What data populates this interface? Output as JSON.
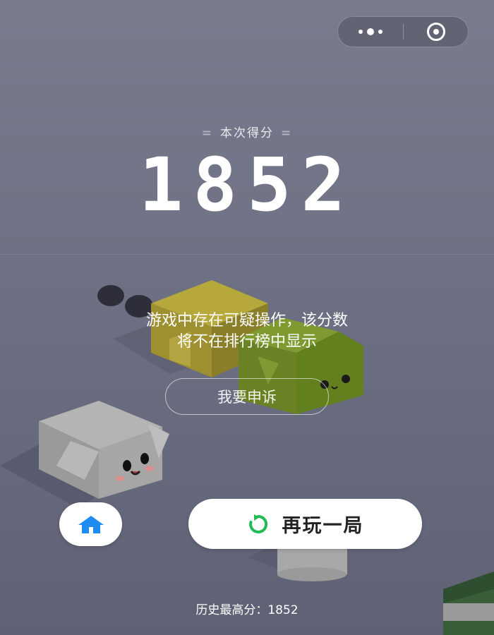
{
  "header": {
    "more_icon": "more-dots-icon",
    "close_icon": "target-circle-icon"
  },
  "score": {
    "label": "本次得分",
    "value": "1852"
  },
  "warning": {
    "line1": "游戏中存在可疑操作，该分数",
    "line2": "将不在排行榜中显示"
  },
  "appeal_button": {
    "label": "我要申诉"
  },
  "actions": {
    "home_icon": "home-icon",
    "replay_icon": "refresh-icon",
    "replay_label": "再玩一局"
  },
  "best": {
    "label": "历史最高分：",
    "value": "1852"
  },
  "colors": {
    "home_icon": "#1e8cf0",
    "replay_icon": "#22bb55",
    "yellow_block": "#a89a2c",
    "green_block": "#6e8a22",
    "gray_block": "#9a9a9a",
    "dark_green_block": "#3a5e3a"
  }
}
